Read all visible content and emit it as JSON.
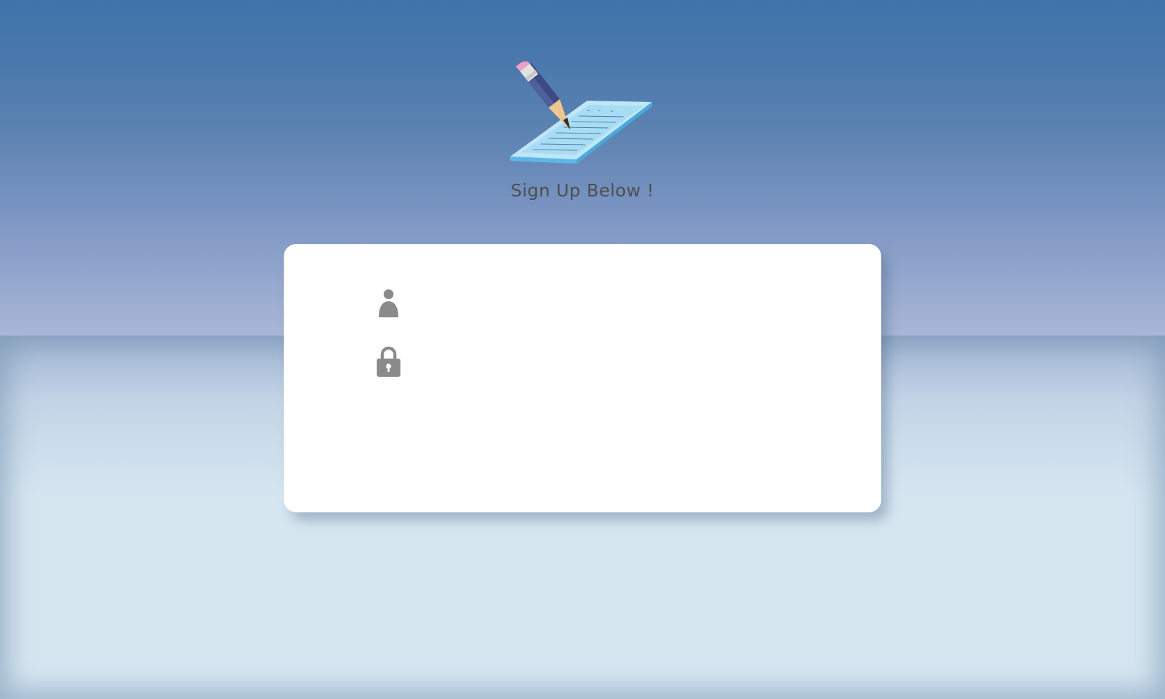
{
  "page": {
    "heading": "Sign Up Below !"
  },
  "form": {
    "username": {
      "icon": "user-icon",
      "value": "",
      "placeholder": ""
    },
    "password": {
      "icon": "lock-icon",
      "value": "",
      "placeholder": ""
    }
  },
  "colors": {
    "sky_top": "#3f74aa",
    "sky_bottom": "#a9b7d7",
    "ground": "#d6e6f1",
    "card": "#ffffff",
    "heading_text": "#4f4f4f",
    "icon_gray": "#8a8a8a"
  }
}
